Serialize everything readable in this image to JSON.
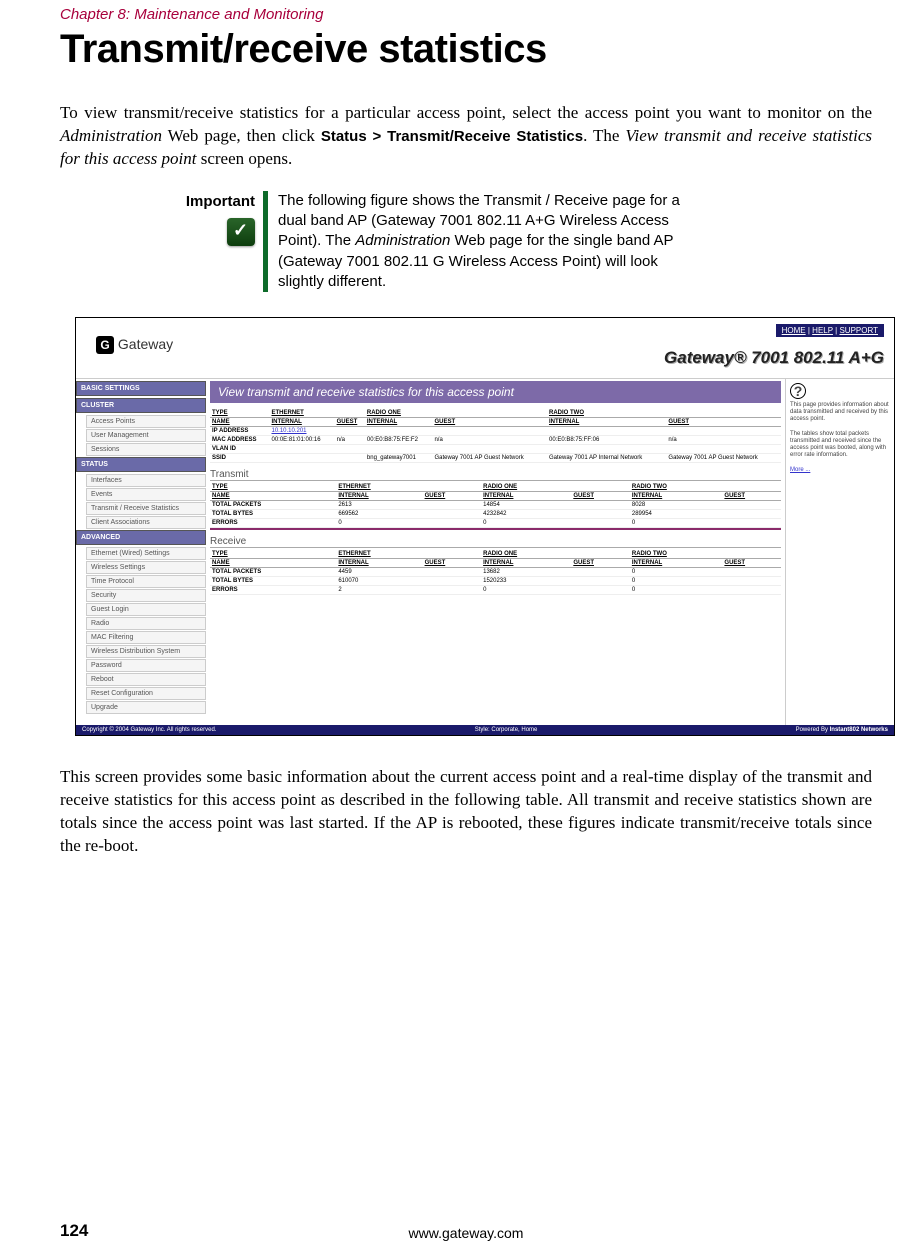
{
  "chapter_header": "Chapter 8: Maintenance and Monitoring",
  "title": "Transmit/receive statistics",
  "intro": {
    "pre": "To view transmit/receive statistics for a particular access point, select the access point you want to monitor on the ",
    "admin": "Administration",
    "mid1": " Web page, then click ",
    "path": "Status > Transmit/Receive Statistics",
    "mid2": ". The ",
    "view": "View transmit and receive statistics for this access point",
    "post": " screen opens."
  },
  "important": {
    "label": "Important",
    "text_pre": "The following figure shows the Transmit / Receive page for a dual band AP (Gateway 7001 802.11 A+G Wireless Access Point). The ",
    "admin": "Administration",
    "text_post": " Web page for the single band AP (Gateway 7001 802.11 G Wireless Access Point) will look slightly different."
  },
  "figure": {
    "logo_text": "Gateway",
    "top_links": [
      "HOME",
      "HELP",
      "SUPPORT"
    ],
    "model": "Gateway® 7001 802.11 A+G",
    "nav": {
      "sections": [
        {
          "header": "BASIC SETTINGS",
          "items": []
        },
        {
          "header": "CLUSTER",
          "items": [
            "Access Points",
            "User Management",
            "Sessions"
          ]
        },
        {
          "header": "STATUS",
          "items": [
            "Interfaces",
            "Events",
            "Transmit / Receive Statistics",
            "Client Associations"
          ]
        },
        {
          "header": "ADVANCED",
          "items": [
            "Ethernet (Wired) Settings",
            "Wireless Settings",
            "Time Protocol",
            "Security",
            "Guest Login",
            "Radio",
            "MAC Filtering",
            "Wireless Distribution System",
            "Password",
            "Reboot",
            "Reset Configuration",
            "Upgrade"
          ]
        }
      ]
    },
    "banner": "View transmit and receive statistics for this access point",
    "table_top": {
      "type_row": [
        "TYPE",
        "ETHERNET",
        "",
        "RADIO ONE",
        "",
        "RADIO TWO",
        ""
      ],
      "name_row": [
        "NAME",
        "INTERNAL",
        "GUEST",
        "INTERNAL",
        "GUEST",
        "INTERNAL",
        "GUEST"
      ],
      "rows": [
        [
          "IP ADDRESS",
          "10.10.10.201",
          "",
          "",
          "",
          "",
          ""
        ],
        [
          "MAC ADDRESS",
          "00:0E:81:01:00:16",
          "n/a",
          "00:E0:B8:75:FE:F2",
          "n/a",
          "00:E0:B8:75:FF:06",
          "n/a"
        ],
        [
          "VLAN ID",
          "",
          "",
          "",
          "",
          "",
          ""
        ],
        [
          "SSID",
          "",
          "",
          "bng_gateway7001",
          "Gateway 7001 AP Guest Network",
          "Gateway 7001 AP Internal Network",
          "Gateway 7001 AP Guest Network"
        ]
      ]
    },
    "transmit": {
      "title": "Transmit",
      "type_row": [
        "TYPE",
        "ETHERNET",
        "",
        "RADIO ONE",
        "",
        "RADIO TWO",
        ""
      ],
      "name_row": [
        "NAME",
        "INTERNAL",
        "GUEST",
        "INTERNAL",
        "GUEST",
        "INTERNAL",
        "GUEST"
      ],
      "rows": [
        [
          "TOTAL PACKETS",
          "2613",
          "",
          "14854",
          "",
          "8028",
          ""
        ],
        [
          "TOTAL BYTES",
          "669562",
          "",
          "4232842",
          "",
          "289954",
          ""
        ],
        [
          "ERRORS",
          "0",
          "",
          "0",
          "",
          "0",
          ""
        ]
      ]
    },
    "receive": {
      "title": "Receive",
      "type_row": [
        "TYPE",
        "ETHERNET",
        "",
        "RADIO ONE",
        "",
        "RADIO TWO",
        ""
      ],
      "name_row": [
        "NAME",
        "INTERNAL",
        "GUEST",
        "INTERNAL",
        "GUEST",
        "INTERNAL",
        "GUEST"
      ],
      "rows": [
        [
          "TOTAL PACKETS",
          "4459",
          "",
          "13682",
          "",
          "0",
          ""
        ],
        [
          "TOTAL BYTES",
          "610070",
          "",
          "1520233",
          "",
          "0",
          ""
        ],
        [
          "ERRORS",
          "2",
          "",
          "0",
          "",
          "0",
          ""
        ]
      ]
    },
    "help": {
      "p1": "This page provides information about data transmitted and received by this access point.",
      "p2": "The tables show total packets transmitted and received since the access point was booted, along with error rate information.",
      "more": "More ..."
    },
    "footer": {
      "left": "Copyright © 2004 Gateway Inc. All rights reserved.",
      "center": "Style: Corporate, Home",
      "right_pre": "Powered By ",
      "right_bold": "Instant802 Networks"
    }
  },
  "closing": "This screen provides some basic information about the current access point and a real-time display of the transmit and receive statistics for this access point as described in the following table. All transmit and receive statistics shown are totals since the access point was last started. If the AP is rebooted, these figures indicate transmit/receive totals since the re-boot.",
  "page_number": "124",
  "footer_url": "www.gateway.com"
}
